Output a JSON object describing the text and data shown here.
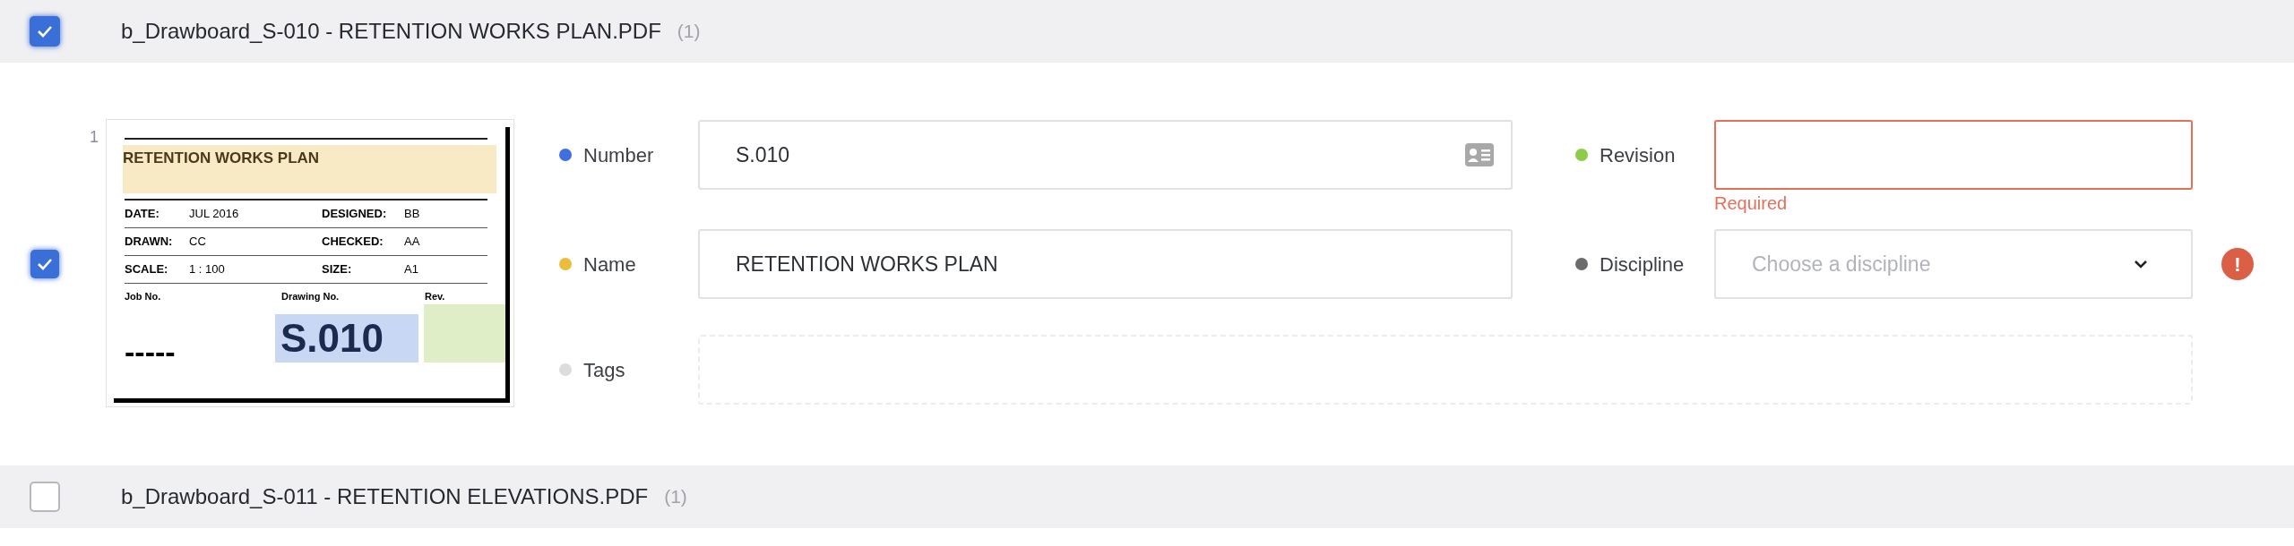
{
  "files": [
    {
      "checked": true,
      "title": "b_Drawboard_S-010 - RETENTION WORKS PLAN.PDF",
      "count": "(1)",
      "sheets": [
        {
          "checked": true,
          "page": "1",
          "thumbnail": {
            "title": "RETENTION WORKS PLAN",
            "rows": [
              [
                "DATE:",
                "JUL 2016",
                "DESIGNED:",
                "BB"
              ],
              [
                "DRAWN:",
                "CC",
                "CHECKED:",
                "AA"
              ],
              [
                "SCALE:",
                "1 : 100",
                "SIZE:",
                "A1"
              ]
            ],
            "job_label": "Job No.",
            "drawing_label": "Drawing No.",
            "rev_label": "Rev.",
            "job_value": "-----",
            "drawing_value": "S.010"
          },
          "fields": {
            "number": {
              "label": "Number",
              "color": "#3f6fe0",
              "value": "S.010"
            },
            "revision": {
              "label": "Revision",
              "color": "#8ccc46",
              "error": "Required"
            },
            "name": {
              "label": "Name",
              "color": "#ecbd3a",
              "value": "RETENTION WORKS PLAN"
            },
            "discipline": {
              "label": "Discipline",
              "color": "#6b6b6b",
              "placeholder": "Choose a discipline",
              "warning": "!"
            },
            "tags": {
              "label": "Tags",
              "color": "#dcdcdc"
            }
          }
        }
      ]
    },
    {
      "checked": false,
      "title": "b_Drawboard_S-011 - RETENTION ELEVATIONS.PDF",
      "count": "(1)"
    }
  ]
}
